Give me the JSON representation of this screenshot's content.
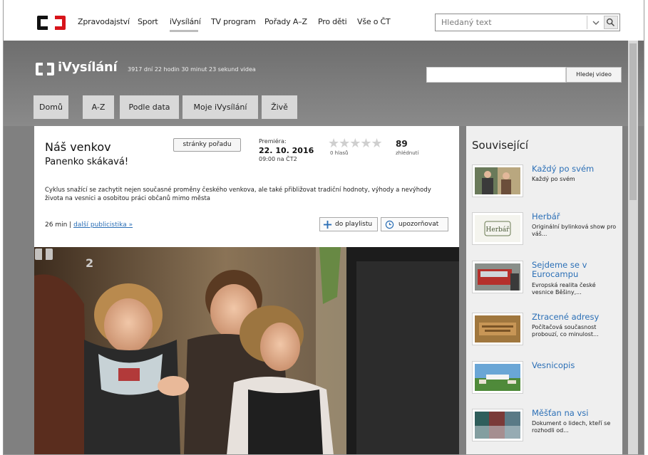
{
  "nav": {
    "items": [
      "Zpravodajství",
      "Sport",
      "iVysílání",
      "TV program",
      "Pořady A–Z",
      "Pro děti",
      "Vše o ČT"
    ],
    "active": "iVysílání",
    "search_placeholder": "Hledaný text"
  },
  "ivysilani": {
    "brand": "iVysílání",
    "stats": "3917 dní 22 hodin 30 minut 23 sekund videa",
    "search_button": "Hledej video",
    "tabs": [
      "Domů",
      "A-Z",
      "Podle data",
      "Moje iVysílání",
      "Živě"
    ]
  },
  "program": {
    "title": "Náš venkov",
    "episode": "Panenko skákavá!",
    "page_button": "stránky pořadu",
    "premiere_label": "Premiéra:",
    "premiere_date": "22. 10. 2016",
    "premiere_time": "09:00 na ČT2",
    "rating_stars": "★★★★★",
    "votes": "0 hlasů",
    "views": "89",
    "views_label": "zhlédnutí",
    "description": "Cyklus snažící se zachytit nejen současné proměny českého venkova, ale také přibližovat tradiční hodnoty, výhody a nevýhody života na vesnici a osobitou práci občanů mimo města",
    "duration": "26 min",
    "more_link": "další publicistika »",
    "playlist_button": "do playlistu",
    "notify_button": "upozorňovat"
  },
  "video": {
    "channel_mark": "2"
  },
  "related": {
    "title": "Související",
    "items": [
      {
        "title": "Každý po svém",
        "desc": "Každý po svém",
        "icon": "people-thumb"
      },
      {
        "title": "Herbář",
        "desc": "Originální bylinková show pro váš...",
        "icon": "herbar-thumb"
      },
      {
        "title": "Sejdeme se v Eurocampu",
        "desc": "Evropská realita české vesnice Běšiny,...",
        "icon": "bus-thumb"
      },
      {
        "title": "Ztracené adresy",
        "desc": "Počítačová současnost probouzí, co minulost...",
        "icon": "sign-thumb"
      },
      {
        "title": "Vesnicopis",
        "desc": "",
        "icon": "village-thumb"
      },
      {
        "title": "Měšťan na vsi",
        "desc": "Dokument o lidech, kteří se rozhodli od...",
        "icon": "numbers-thumb"
      }
    ]
  },
  "colors": {
    "band": "#7a7a7a",
    "link": "#2b6fb6",
    "ct_logo": "#d7141a"
  }
}
